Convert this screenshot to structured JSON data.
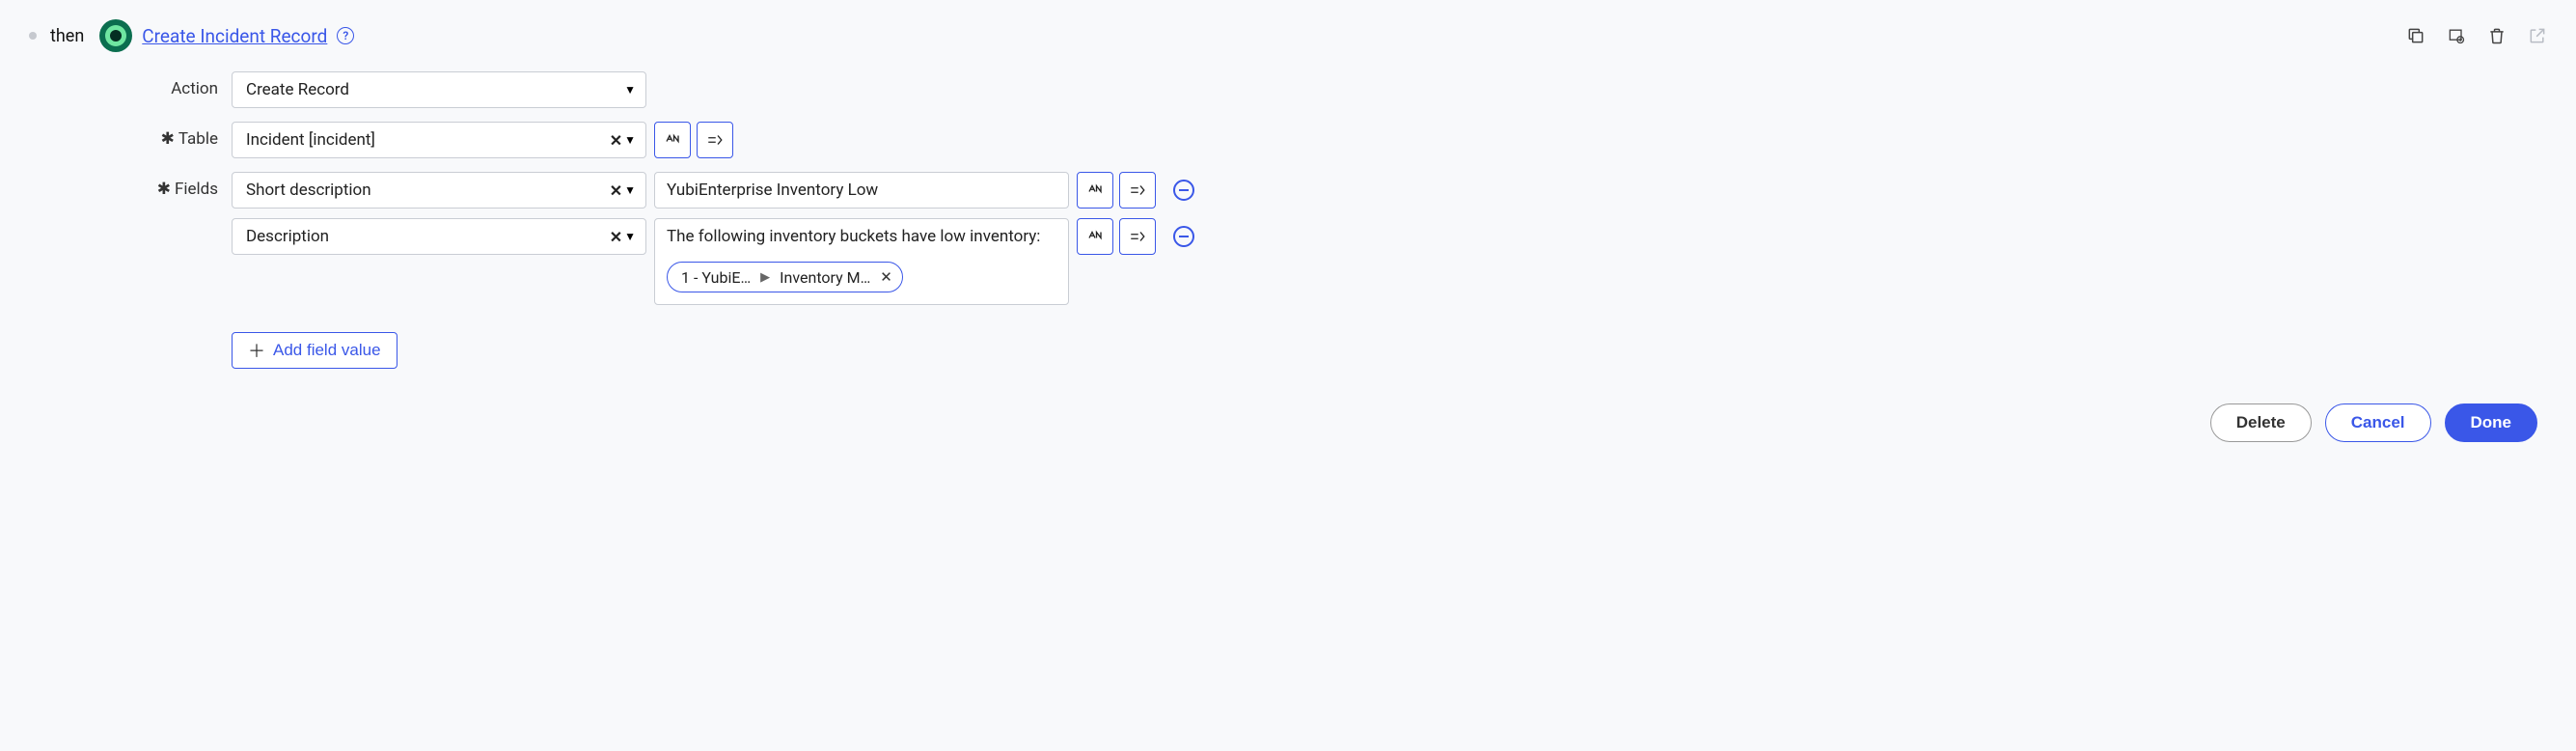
{
  "header": {
    "then": "then",
    "title": "Create Incident Record",
    "help_glyph": "?"
  },
  "labels": {
    "action": "Action",
    "table": "Table",
    "fields": "Fields",
    "required": "✱"
  },
  "action_select": {
    "value": "Create Record"
  },
  "table_select": {
    "value": "Incident [incident]"
  },
  "field_rows": [
    {
      "field_name": "Short description",
      "value_text": "YubiEnterprise Inventory Low",
      "pills": []
    },
    {
      "field_name": "Description",
      "value_text": "The following inventory buckets have low inventory:",
      "pills": [
        {
          "left": "1 - YubiE…",
          "right": "Inventory M…"
        }
      ]
    }
  ],
  "add_field_label": "Add field value",
  "footer": {
    "delete": "Delete",
    "cancel": "Cancel",
    "done": "Done"
  }
}
